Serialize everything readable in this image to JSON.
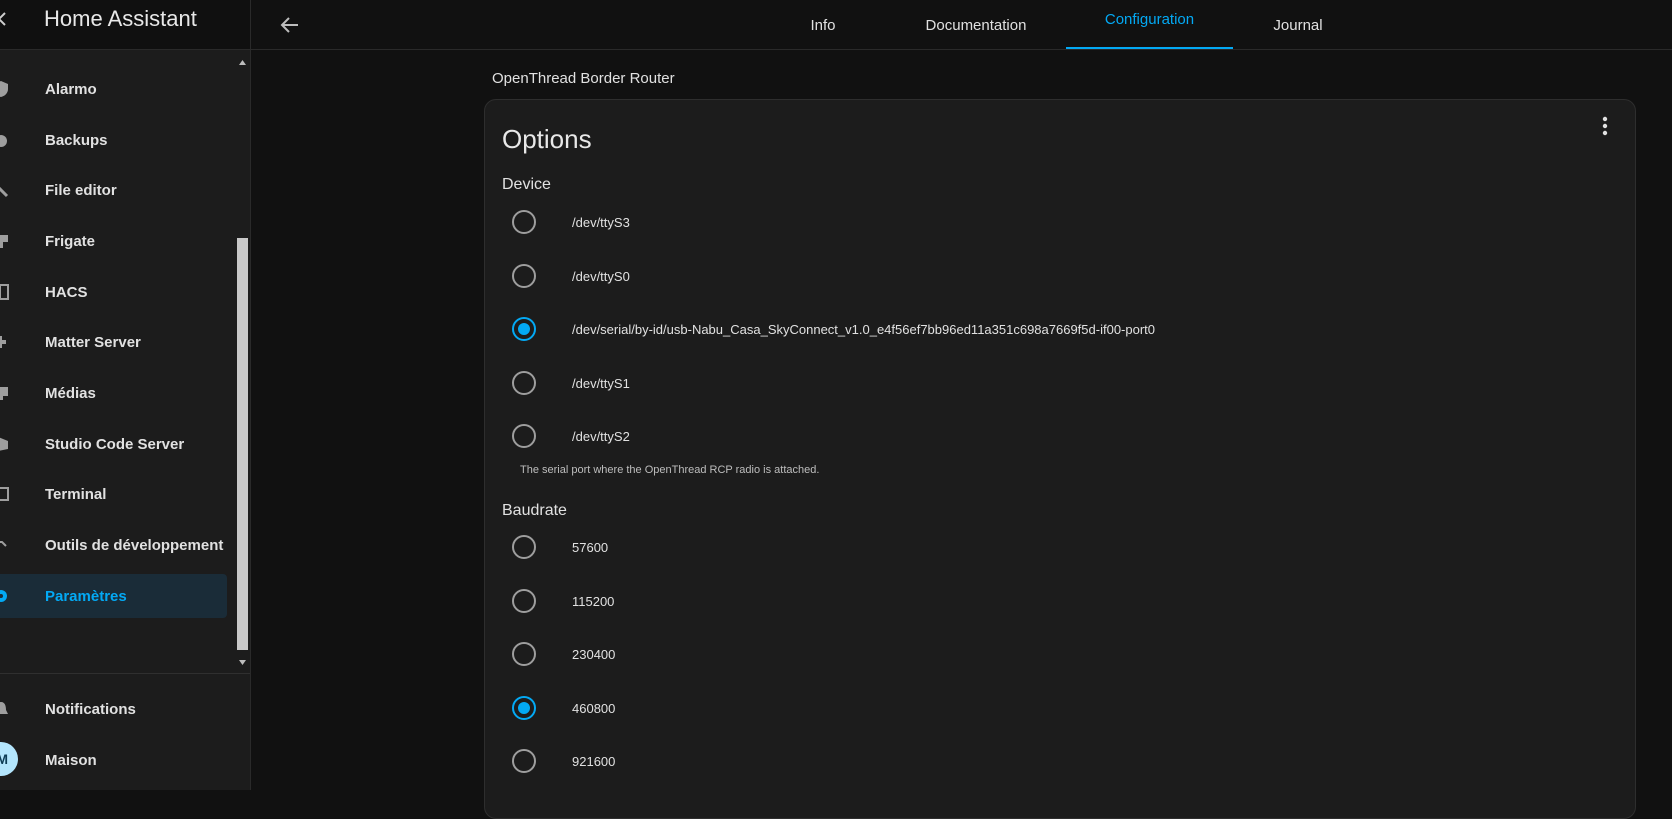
{
  "app": {
    "title": "Home Assistant"
  },
  "sidebar": {
    "items": [
      {
        "label": "Alarmo",
        "icon": "shield-icon"
      },
      {
        "label": "Backups",
        "icon": "cloud-icon"
      },
      {
        "label": "File editor",
        "icon": "wrench-icon"
      },
      {
        "label": "Frigate",
        "icon": "cctv-icon"
      },
      {
        "label": "HACS",
        "icon": "hacs-icon"
      },
      {
        "label": "Matter Server",
        "icon": "puzzle-icon"
      },
      {
        "label": "Médias",
        "icon": "media-icon"
      },
      {
        "label": "Studio Code Server",
        "icon": "code-icon"
      },
      {
        "label": "Terminal",
        "icon": "terminal-icon"
      },
      {
        "label": "Outils de développement",
        "icon": "hammer-icon"
      },
      {
        "label": "Paramètres",
        "icon": "cog-icon",
        "active": true
      }
    ],
    "bottom": [
      {
        "label": "Notifications",
        "icon": "bell-icon"
      },
      {
        "label": "Maison",
        "icon": "user-avatar"
      }
    ]
  },
  "topbar": {
    "tabs": [
      {
        "label": "Info"
      },
      {
        "label": "Documentation"
      },
      {
        "label": "Configuration",
        "active": true
      },
      {
        "label": "Journal"
      }
    ]
  },
  "main": {
    "addon_name": "OpenThread Border Router",
    "card_title": "Options",
    "device": {
      "label": "Device",
      "options": [
        "/dev/ttyS3",
        "/dev/ttyS0",
        "/dev/serial/by-id/usb-Nabu_Casa_SkyConnect_v1.0_e4f56ef7bb96ed11a351c698a7669f5d-if00-port0",
        "/dev/ttyS1",
        "/dev/ttyS2"
      ],
      "selected": 2,
      "helper": "The serial port where the OpenThread RCP radio is attached."
    },
    "baudrate": {
      "label": "Baudrate",
      "options": [
        "57600",
        "115200",
        "230400",
        "460800",
        "921600"
      ],
      "selected": 3
    }
  },
  "colors": {
    "accent": "#03a9f4",
    "background": "#111111",
    "card": "#1c1c1c"
  }
}
